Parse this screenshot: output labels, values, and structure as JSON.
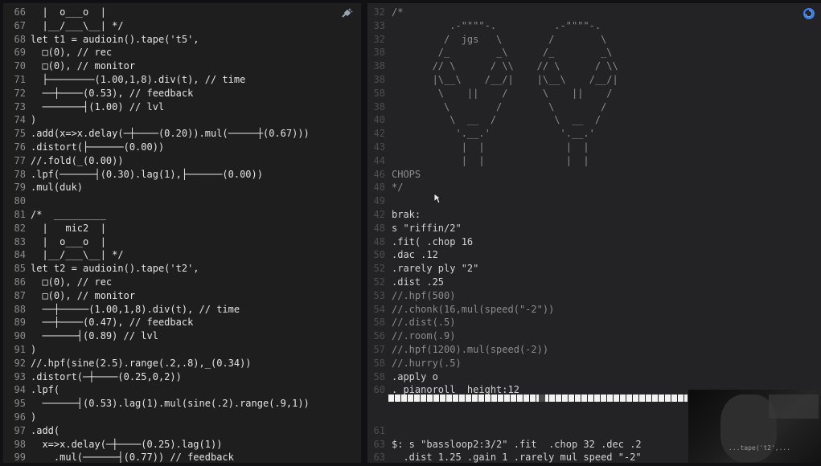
{
  "left_editor": {
    "lines": [
      {
        "num": "66",
        "text": "  |  o___o  |"
      },
      {
        "num": "67",
        "text": "  |__/___\\__| */"
      },
      {
        "num": "68",
        "text": "let t1 = audioin().tape('t5',"
      },
      {
        "num": "69",
        "text": "  □(0), // rec"
      },
      {
        "num": "70",
        "text": "  □(0), // monitor"
      },
      {
        "num": "71",
        "text": "  ├────────(1.00,1,8).div(t), // time"
      },
      {
        "num": "72",
        "text": "  ──┼────(0.53), // feedback"
      },
      {
        "num": "73",
        "text": "  ───────┤(1.00) // lvl"
      },
      {
        "num": "74",
        "text": ")"
      },
      {
        "num": "75",
        "text": ".add(x=>x.delay(─┼────(0.20)).mul(─────┼(0.67)))"
      },
      {
        "num": "76",
        "text": ".distort(├──────(0.00))"
      },
      {
        "num": "77",
        "text": "//.fold(_(0.00))"
      },
      {
        "num": "78",
        "text": ".lpf(──────┤(0.30).lag(1),├──────(0.00))"
      },
      {
        "num": "79",
        "text": ".mul(duk)"
      },
      {
        "num": "80",
        "text": ""
      },
      {
        "num": "81",
        "text": "/*  _________"
      },
      {
        "num": "82",
        "text": "  |   mic2  |"
      },
      {
        "num": "83",
        "text": "  |  o___o  |"
      },
      {
        "num": "84",
        "text": "  |__/___\\__| */"
      },
      {
        "num": "85",
        "text": "let t2 = audioin().tape('t2',"
      },
      {
        "num": "86",
        "text": "  □(0), // rec"
      },
      {
        "num": "87",
        "text": "  □(0), // monitor"
      },
      {
        "num": "88",
        "text": "  ──┼─────(1.00,1,8).div(t), // time"
      },
      {
        "num": "89",
        "text": "  ──┼────(0.47), // feedback"
      },
      {
        "num": "90",
        "text": "  ──────┤(0.89) // lvl"
      },
      {
        "num": "91",
        "text": ")"
      },
      {
        "num": "92",
        "text": "//.hpf(sine(2.5).range(.2,.8),_(0.34))"
      },
      {
        "num": "93",
        "text": ".distort(─┼────(0.25,0,2))"
      },
      {
        "num": "94",
        "text": ".lpf("
      },
      {
        "num": "95",
        "text": "  ──────┤(0.53).lag(1).mul(sine(.2).range(.9,1))"
      },
      {
        "num": "96",
        "text": ")"
      },
      {
        "num": "97",
        "text": ".add("
      },
      {
        "num": "98",
        "text": "  x=>x.delay(─┼────(0.25).lag(1))"
      },
      {
        "num": "99",
        "text": "    .mul(──────┤(0.77)) // feedback"
      }
    ]
  },
  "right_editor": {
    "lines": [
      {
        "num": "32",
        "text": "/*",
        "hl": false
      },
      {
        "num": "33",
        "text": "          .-\"\"\"\"-.          .-\"\"\"\"-.",
        "hl": false
      },
      {
        "num": "32",
        "text": "         /  jgs   \\        /        \\",
        "hl": false
      },
      {
        "num": "38",
        "text": "        /_        _\\      /_        _\\",
        "hl": false
      },
      {
        "num": "38",
        "text": "       // \\      / \\\\    // \\      / \\\\",
        "hl": false
      },
      {
        "num": "38",
        "text": "       |\\__\\    /__/|    |\\__\\    /__/|",
        "hl": false
      },
      {
        "num": "58",
        "text": "        \\    ||    /      \\    ||    /",
        "hl": false
      },
      {
        "num": "38",
        "text": "         \\        /        \\        /",
        "hl": false
      },
      {
        "num": "40",
        "text": "          \\  __  /          \\  __  /",
        "hl": false
      },
      {
        "num": "42",
        "text": "           '.__.'            '.__.'",
        "hl": false
      },
      {
        "num": "43",
        "text": "            |  |              |  |",
        "hl": false
      },
      {
        "num": "44",
        "text": "            |  |              |  |",
        "hl": false
      },
      {
        "num": "46",
        "text": "CHOPS",
        "hl": false
      },
      {
        "num": "48",
        "text": "*/",
        "hl": false
      },
      {
        "num": "49",
        "text": "",
        "hl": false
      },
      {
        "num": "42",
        "text": "brak:",
        "hl": true
      },
      {
        "num": "48",
        "text": "s \"riffin/2\"",
        "hl": true
      },
      {
        "num": "48",
        "text": ".fit( .chop 16",
        "hl": true
      },
      {
        "num": "50",
        "text": ".dac .12",
        "hl": true
      },
      {
        "num": "52",
        "text": ".rarely ply \"2\"",
        "hl": true
      },
      {
        "num": "52",
        "text": ".dist .25",
        "hl": true
      },
      {
        "num": "53",
        "text": "//.hpf(500)",
        "hl": false
      },
      {
        "num": "54",
        "text": "//.chonk(16,mul(speed(\"-2\"))",
        "hl": false
      },
      {
        "num": "58",
        "text": "//.dist(.5)",
        "hl": false
      },
      {
        "num": "56",
        "text": "//.room(.9)",
        "hl": false
      },
      {
        "num": "57",
        "text": "//.hpf(1200).mul(speed(-2))",
        "hl": false
      },
      {
        "num": "58",
        "text": "//.hurry(.5)",
        "hl": false
      },
      {
        "num": "58",
        "text": ".apply o",
        "hl": true
      },
      {
        "num": "60",
        "text": "._pianoroll  height:12",
        "hl": true
      },
      {
        "num": "",
        "text": "",
        "hl": false
      },
      {
        "num": "",
        "text": "",
        "hl": false
      },
      {
        "num": "61",
        "text": "",
        "hl": false
      },
      {
        "num": "63",
        "text": "$: s \"bassloop2:3/2\" .fit  .chop 32 .dec .2",
        "hl": true
      },
      {
        "num": "63",
        "text": "  .dist 1.25 .gain 1 .rarely mul speed \"-2\"",
        "hl": true
      }
    ]
  },
  "webcam": {
    "caption": "...tape('t2',..."
  },
  "icons": {
    "plugin": "plug-icon",
    "logo": "strudel-swirl-icon",
    "cursor": "mouse-cursor-icon"
  },
  "colors": {
    "left_bg": "#1e1e1f",
    "right_bg": "#232325",
    "accent": "#3b82f6"
  }
}
